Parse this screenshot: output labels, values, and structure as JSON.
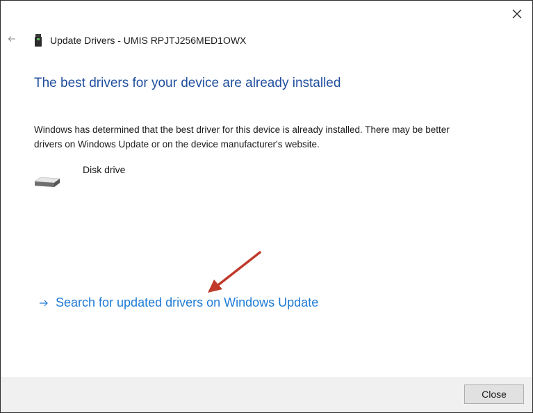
{
  "window": {
    "title": "Update Drivers - UMIS RPJTJ256MED1OWX"
  },
  "icons": {
    "close": "close-icon",
    "back": "back-arrow-icon",
    "device": "usb-device-icon",
    "disk": "disk-drive-icon",
    "link": "arrow-right-icon"
  },
  "main": {
    "heading": "The best drivers for your device are already installed",
    "description": "Windows has determined that the best driver for this device is already installed. There may be better drivers on Windows Update or on the device manufacturer's website.",
    "device_name": "Disk drive",
    "update_link": "Search for updated drivers on Windows Update"
  },
  "footer": {
    "close_label": "Close"
  },
  "colors": {
    "heading": "#1f4e9d",
    "link": "#1e7bd6",
    "annotation_arrow": "#c0392b",
    "footer_bg": "#f0f0f0"
  }
}
